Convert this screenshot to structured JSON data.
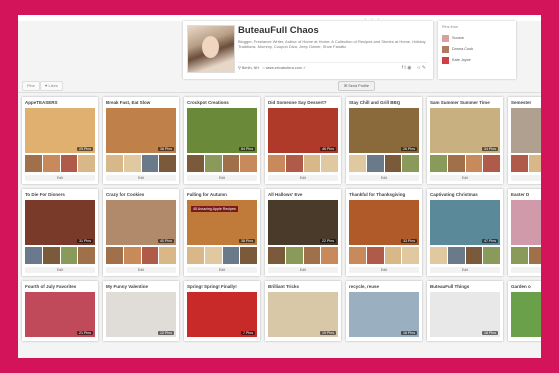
{
  "profile": {
    "title": "ButeauFull Chaos",
    "bio": "Blogger, Freelance Writer, Author of Home at Home: A Collection of Recipes and Stories at Home, Holiday Traditions, Mommy, Coupon Diva, Jeep Owner, Shoe Fanatic",
    "location": "Berlin, NH",
    "website": "www.ericabutera.com"
  },
  "pinned": {
    "header": "Pins from",
    "rows": [
      "Source",
      "Donna Cook",
      "Kate Joyce"
    ]
  },
  "tabs": {
    "pins": "Pins",
    "likes": "Likes",
    "send_profile": "Send Profile"
  },
  "edit_label": "Edit",
  "boards": [
    {
      "title": "AppeTEASERS",
      "pins": "25 Pins",
      "cover": "#e0b070"
    },
    {
      "title": "Break Fast, Eat Slow",
      "pins": "36 Pins",
      "cover": "#c0804a"
    },
    {
      "title": "Crockpot Creations",
      "pins": "84 Pins",
      "cover": "#6a8a3a"
    },
    {
      "title": "Did Someone Say Dessert?",
      "pins": "46 Pins",
      "cover": "#b03a2a"
    },
    {
      "title": "Stay Chill and Grill BBQ",
      "pins": "26 Pins",
      "cover": "#8a6a3a"
    },
    {
      "title": "Sam Summer Summer Time",
      "pins": "34 Pins",
      "cover": "#c8b080"
    },
    {
      "title": "Semester",
      "pins": "",
      "cover": "#b0a090"
    },
    {
      "title": "To Die For Dinners",
      "pins": "31 Pins",
      "cover": "#7a3a2a"
    },
    {
      "title": "Crazy for Cookies",
      "pins": "40 Pins",
      "cover": "#b08a6a"
    },
    {
      "title": "Falling for Autumn",
      "pins": "38 Pins",
      "cover": "#c07a3a"
    },
    {
      "title": "All Hallows' Eve",
      "pins": "22 Pins",
      "cover": "#4a3a2a"
    },
    {
      "title": "Thankful for Thanksgiving",
      "pins": "33 Pins",
      "cover": "#b05a2a"
    },
    {
      "title": "Captivating Christmas",
      "pins": "47 Pins",
      "cover": "#5a8a9a"
    },
    {
      "title": "Easter D",
      "pins": "",
      "cover": "#d09aaa"
    },
    {
      "title": "Fourth of July Favorites",
      "pins": "21 Pins",
      "cover": "#c04a5a"
    },
    {
      "title": "My Funny Valentine",
      "pins": "12 Pins",
      "cover": "#e0dcd8"
    },
    {
      "title": "Spring! Spring! Finally!",
      "pins": "7 Pins",
      "cover": "#c82a2a"
    },
    {
      "title": "Brilliant Tricks",
      "pins": "19 Pins",
      "cover": "#d8c8a8"
    },
    {
      "title": "recycle, reuse",
      "pins": "16 Pins",
      "cover": "#9ab0c0"
    },
    {
      "title": "ButeauFull Things",
      "pins": "18 Pins",
      "cover": "#e8e8e8"
    },
    {
      "title": "Garden o",
      "pins": "",
      "cover": "#6aa04a"
    }
  ],
  "cover_label": "45 Amazing Apple Recipes",
  "colors": {
    "frame_bg": "#d4145a",
    "page_bg": "#f4f4f4"
  }
}
